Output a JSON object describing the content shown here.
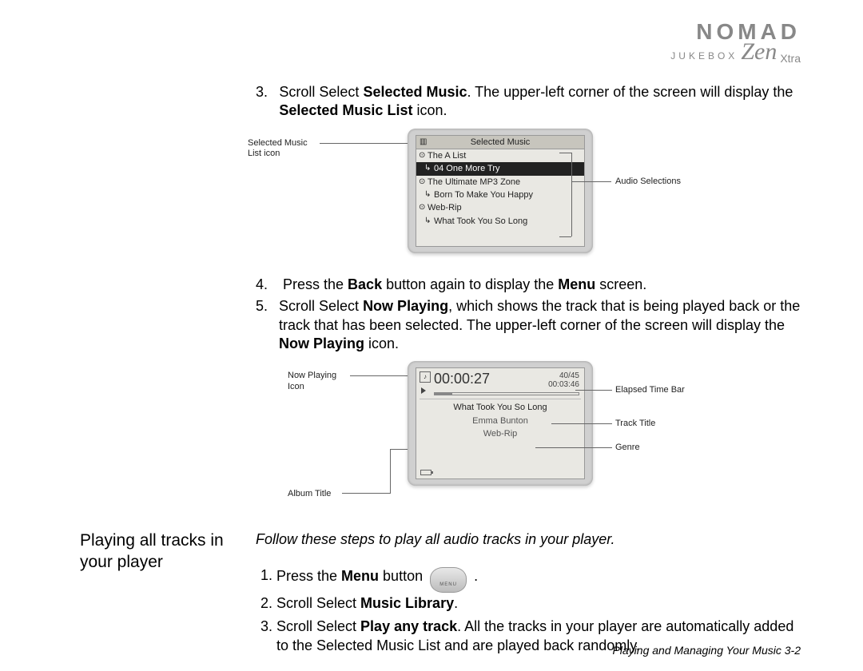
{
  "logo": {
    "brand": "NOMAD",
    "sub": "JUKEBOX",
    "model": "Zen",
    "suffix": "Xtra"
  },
  "step3": {
    "num": "3.",
    "text_a": "Scroll Select ",
    "bold_a": "Selected Music",
    "text_b": ". The upper-left corner of the screen will display the ",
    "bold_b": "Selected Music List",
    "text_c": " icon."
  },
  "fig1": {
    "label_left": "Selected Music List icon",
    "label_right": "Audio Selections",
    "screen_title": "Selected Music",
    "rows": [
      {
        "bullet": "⊙",
        "text": "The A List",
        "child": false,
        "sel": false
      },
      {
        "bullet": "↳",
        "text": "04 One More Try",
        "child": true,
        "sel": true
      },
      {
        "bullet": "⊙",
        "text": "The Ultimate MP3 Zone",
        "child": false,
        "sel": false
      },
      {
        "bullet": "↳",
        "text": "Born To Make You Happy",
        "child": true,
        "sel": false
      },
      {
        "bullet": "⊙",
        "text": "Web-Rip",
        "child": false,
        "sel": false
      },
      {
        "bullet": "↳",
        "text": "What Took You So Long",
        "child": true,
        "sel": false
      }
    ]
  },
  "step4": {
    "num": "4.",
    "text_a": "Press the ",
    "bold_a": "Back",
    "text_b": " button again to display the ",
    "bold_b": "Menu",
    "text_c": " screen."
  },
  "step5": {
    "num": "5.",
    "text_a": "Scroll Select ",
    "bold_a": "Now Playing",
    "text_b": ", which shows the track that is being played back or the track that has been selected. The upper-left corner of the screen will display the ",
    "bold_b": "Now Playing",
    "text_c": " icon."
  },
  "fig2": {
    "label_np_icon": "Now Playing Icon",
    "label_album": "Album Title",
    "label_elapsed": "Elapsed Time Bar",
    "label_track": "Track Title",
    "label_genre": "Genre",
    "elapsed": "00:00:27",
    "count": "40/45",
    "total": "00:03:46",
    "track": "What Took You So Long",
    "artist": "Emma Bunton",
    "album": "Web-Rip"
  },
  "section2": {
    "heading": "Playing all tracks in your player",
    "lead": "Follow these steps to play all audio tracks in your player.",
    "s1_a": "Press the ",
    "s1_bold": "Menu",
    "s1_b": " button ",
    "s1_c": ".",
    "menu_btn": "MENU",
    "s2_a": "Scroll Select ",
    "s2_bold": "Music Library",
    "s2_b": ".",
    "s3_a": "Scroll Select ",
    "s3_bold": "Play any track",
    "s3_b": ". All the tracks in your player are automatically added to the Selected Music List and are played back randomly."
  },
  "footer": "Playing and Managing Your Music 3-2"
}
